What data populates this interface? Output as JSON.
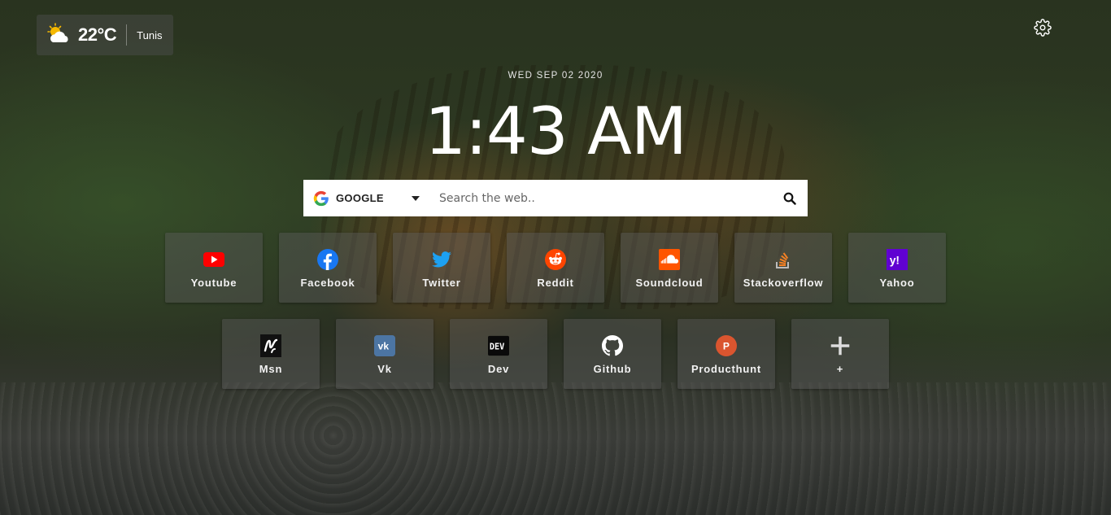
{
  "weather": {
    "temperature": "22°C",
    "city": "Tunis",
    "icon": "partly-cloudy-icon"
  },
  "settings": {
    "icon": "gear-icon"
  },
  "clock": {
    "date": "WED SEP 02 2020",
    "time": "1:43 AM"
  },
  "search": {
    "engine": "GOOGLE",
    "placeholder": "Search the web..",
    "icon": "search-icon"
  },
  "shortcuts": [
    {
      "label": "Youtube",
      "icon": "youtube-icon"
    },
    {
      "label": "Facebook",
      "icon": "facebook-icon"
    },
    {
      "label": "Twitter",
      "icon": "twitter-icon"
    },
    {
      "label": "Reddit",
      "icon": "reddit-icon"
    },
    {
      "label": "Soundcloud",
      "icon": "soundcloud-icon"
    },
    {
      "label": "Stackoverflow",
      "icon": "stackoverflow-icon"
    },
    {
      "label": "Yahoo",
      "icon": "yahoo-icon"
    },
    {
      "label": "Msn",
      "icon": "msn-icon"
    },
    {
      "label": "Vk",
      "icon": "vk-icon"
    },
    {
      "label": "Dev",
      "icon": "dev-icon"
    },
    {
      "label": "Github",
      "icon": "github-icon"
    },
    {
      "label": "Producthunt",
      "icon": "producthunt-icon"
    },
    {
      "label": "+",
      "icon": "plus-icon"
    }
  ],
  "colors": {
    "youtube": "#ff0000",
    "facebook": "#1877f2",
    "twitter": "#1da1f2",
    "reddit": "#ff4500",
    "soundcloud": "#ff5500",
    "stackoverflow": "#f48024",
    "yahoo": "#6001d2",
    "vk": "#4c75a3",
    "producthunt": "#da552f"
  }
}
